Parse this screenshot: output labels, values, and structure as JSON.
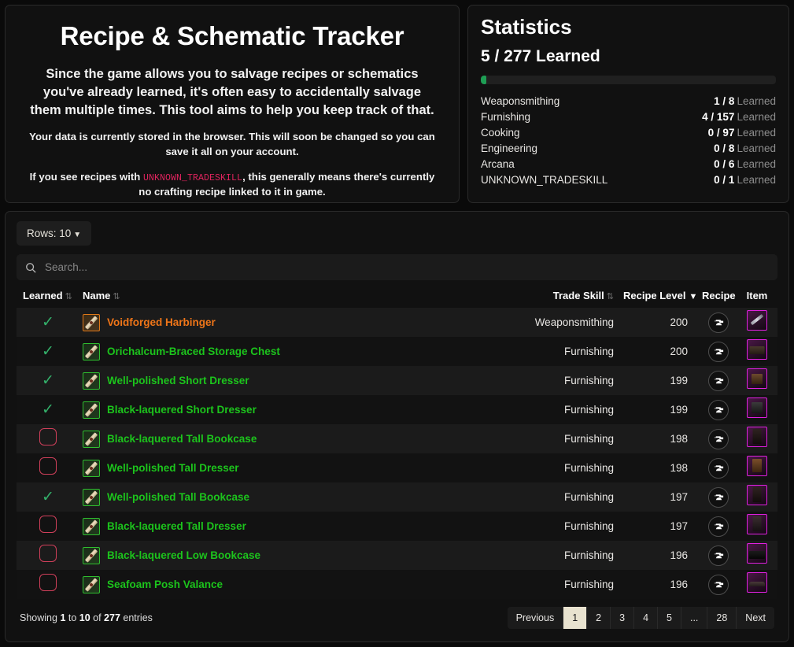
{
  "intro": {
    "title": "Recipe & Schematic Tracker",
    "lead": "Since the game allows you to salvage recipes or schematics you've already learned, it's often easy to accidentally salvage them multiple times. This tool aims to help you keep track of that.",
    "storage_note": "Your data is currently stored in the browser. This will soon be changed so you can save it all on your account.",
    "unknown_note_pre": "If you see recipes with ",
    "unknown_token": "UNKNOWN_TRADESKILL",
    "unknown_note_post": ", this generally means there's currently no crafting recipe linked to it in game."
  },
  "stats": {
    "title": "Statistics",
    "learned_summary": "5 / 277 Learned",
    "progress_percent": 1.8,
    "learned_suffix": "Learned",
    "skills": [
      {
        "name": "Weaponsmithing",
        "value": "1 / 8"
      },
      {
        "name": "Furnishing",
        "value": "4 / 157"
      },
      {
        "name": "Cooking",
        "value": "0 / 97"
      },
      {
        "name": "Engineering",
        "value": "0 / 8"
      },
      {
        "name": "Arcana",
        "value": "0 / 6"
      },
      {
        "name": "UNKNOWN_TRADESKILL",
        "value": "0 / 1"
      }
    ]
  },
  "toolbar": {
    "rows_label": "Rows: 10",
    "rows_caret": "▼",
    "search_placeholder": "Search..."
  },
  "table": {
    "headers": {
      "learned": "Learned",
      "name": "Name",
      "trade_skill": "Trade Skill",
      "recipe_level": "Recipe Level",
      "recipe": "Recipe",
      "item": "Item"
    },
    "sort_icon": "⇅",
    "sort_desc_icon": "▼",
    "rows": [
      {
        "learned": true,
        "name": "Voidforged Harbinger",
        "rarity": "orange",
        "trade_skill": "Weaponsmithing",
        "level": "200",
        "item_class": "it-weapon"
      },
      {
        "learned": true,
        "name": "Orichalcum-Braced Storage Chest",
        "rarity": "green",
        "trade_skill": "Furnishing",
        "level": "200",
        "item_class": "it-chest"
      },
      {
        "learned": true,
        "name": "Well-polished Short Dresser",
        "rarity": "green",
        "trade_skill": "Furnishing",
        "level": "199",
        "item_class": "it-dresserS"
      },
      {
        "learned": true,
        "name": "Black-laquered Short Dresser",
        "rarity": "green",
        "trade_skill": "Furnishing",
        "level": "199",
        "item_class": "it-dresserD"
      },
      {
        "learned": false,
        "name": "Black-laquered Tall Bookcase",
        "rarity": "green",
        "trade_skill": "Furnishing",
        "level": "198",
        "item_class": "it-bookTall"
      },
      {
        "learned": false,
        "name": "Well-polished Tall Dresser",
        "rarity": "green",
        "trade_skill": "Furnishing",
        "level": "198",
        "item_class": "it-chairTall"
      },
      {
        "learned": true,
        "name": "Well-polished Tall Bookcase",
        "rarity": "green",
        "trade_skill": "Furnishing",
        "level": "197",
        "item_class": "it-bookTall"
      },
      {
        "learned": false,
        "name": "Black-laquered Tall Dresser",
        "rarity": "green",
        "trade_skill": "Furnishing",
        "level": "197",
        "item_class": "it-bookDark"
      },
      {
        "learned": false,
        "name": "Black-laquered Low Bookcase",
        "rarity": "green",
        "trade_skill": "Furnishing",
        "level": "196",
        "item_class": "it-lowBook"
      },
      {
        "learned": false,
        "name": "Seafoam Posh Valance",
        "rarity": "green",
        "trade_skill": "Furnishing",
        "level": "196",
        "item_class": "it-valance"
      }
    ]
  },
  "footer": {
    "showing_pre": "Showing ",
    "showing_from": "1",
    "showing_mid": " to ",
    "showing_to": "10",
    "showing_of": " of ",
    "showing_total": "277",
    "showing_post": " entries",
    "pages": [
      {
        "label": "Previous",
        "active": false
      },
      {
        "label": "1",
        "active": true
      },
      {
        "label": "2",
        "active": false
      },
      {
        "label": "3",
        "active": false
      },
      {
        "label": "4",
        "active": false
      },
      {
        "label": "5",
        "active": false
      },
      {
        "label": "...",
        "active": false
      },
      {
        "label": "28",
        "active": false
      },
      {
        "label": "Next",
        "active": false
      }
    ]
  },
  "colors": {
    "accent_green": "#1cc41c",
    "accent_orange": "#ef7518",
    "progress_green": "#1e9e54",
    "unknown_red": "#e0245e",
    "item_border_magenta": "#e020e0",
    "checkbox_red": "#cf3f5a"
  }
}
